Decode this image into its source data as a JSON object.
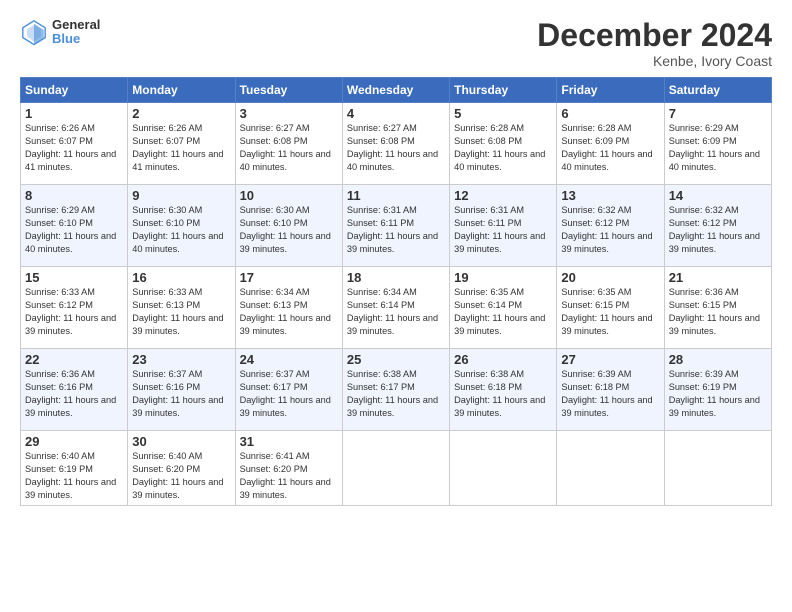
{
  "header": {
    "logo_text_top": "General",
    "logo_text_bottom": "Blue",
    "month_title": "December 2024",
    "location": "Kenbe, Ivory Coast"
  },
  "weekdays": [
    "Sunday",
    "Monday",
    "Tuesday",
    "Wednesday",
    "Thursday",
    "Friday",
    "Saturday"
  ],
  "weeks": [
    [
      {
        "day": "1",
        "sunrise": "6:26 AM",
        "sunset": "6:07 PM",
        "daylight": "11 hours and 41 minutes."
      },
      {
        "day": "2",
        "sunrise": "6:26 AM",
        "sunset": "6:07 PM",
        "daylight": "11 hours and 41 minutes."
      },
      {
        "day": "3",
        "sunrise": "6:27 AM",
        "sunset": "6:08 PM",
        "daylight": "11 hours and 40 minutes."
      },
      {
        "day": "4",
        "sunrise": "6:27 AM",
        "sunset": "6:08 PM",
        "daylight": "11 hours and 40 minutes."
      },
      {
        "day": "5",
        "sunrise": "6:28 AM",
        "sunset": "6:08 PM",
        "daylight": "11 hours and 40 minutes."
      },
      {
        "day": "6",
        "sunrise": "6:28 AM",
        "sunset": "6:09 PM",
        "daylight": "11 hours and 40 minutes."
      },
      {
        "day": "7",
        "sunrise": "6:29 AM",
        "sunset": "6:09 PM",
        "daylight": "11 hours and 40 minutes."
      }
    ],
    [
      {
        "day": "8",
        "sunrise": "6:29 AM",
        "sunset": "6:10 PM",
        "daylight": "11 hours and 40 minutes."
      },
      {
        "day": "9",
        "sunrise": "6:30 AM",
        "sunset": "6:10 PM",
        "daylight": "11 hours and 40 minutes."
      },
      {
        "day": "10",
        "sunrise": "6:30 AM",
        "sunset": "6:10 PM",
        "daylight": "11 hours and 39 minutes."
      },
      {
        "day": "11",
        "sunrise": "6:31 AM",
        "sunset": "6:11 PM",
        "daylight": "11 hours and 39 minutes."
      },
      {
        "day": "12",
        "sunrise": "6:31 AM",
        "sunset": "6:11 PM",
        "daylight": "11 hours and 39 minutes."
      },
      {
        "day": "13",
        "sunrise": "6:32 AM",
        "sunset": "6:12 PM",
        "daylight": "11 hours and 39 minutes."
      },
      {
        "day": "14",
        "sunrise": "6:32 AM",
        "sunset": "6:12 PM",
        "daylight": "11 hours and 39 minutes."
      }
    ],
    [
      {
        "day": "15",
        "sunrise": "6:33 AM",
        "sunset": "6:12 PM",
        "daylight": "11 hours and 39 minutes."
      },
      {
        "day": "16",
        "sunrise": "6:33 AM",
        "sunset": "6:13 PM",
        "daylight": "11 hours and 39 minutes."
      },
      {
        "day": "17",
        "sunrise": "6:34 AM",
        "sunset": "6:13 PM",
        "daylight": "11 hours and 39 minutes."
      },
      {
        "day": "18",
        "sunrise": "6:34 AM",
        "sunset": "6:14 PM",
        "daylight": "11 hours and 39 minutes."
      },
      {
        "day": "19",
        "sunrise": "6:35 AM",
        "sunset": "6:14 PM",
        "daylight": "11 hours and 39 minutes."
      },
      {
        "day": "20",
        "sunrise": "6:35 AM",
        "sunset": "6:15 PM",
        "daylight": "11 hours and 39 minutes."
      },
      {
        "day": "21",
        "sunrise": "6:36 AM",
        "sunset": "6:15 PM",
        "daylight": "11 hours and 39 minutes."
      }
    ],
    [
      {
        "day": "22",
        "sunrise": "6:36 AM",
        "sunset": "6:16 PM",
        "daylight": "11 hours and 39 minutes."
      },
      {
        "day": "23",
        "sunrise": "6:37 AM",
        "sunset": "6:16 PM",
        "daylight": "11 hours and 39 minutes."
      },
      {
        "day": "24",
        "sunrise": "6:37 AM",
        "sunset": "6:17 PM",
        "daylight": "11 hours and 39 minutes."
      },
      {
        "day": "25",
        "sunrise": "6:38 AM",
        "sunset": "6:17 PM",
        "daylight": "11 hours and 39 minutes."
      },
      {
        "day": "26",
        "sunrise": "6:38 AM",
        "sunset": "6:18 PM",
        "daylight": "11 hours and 39 minutes."
      },
      {
        "day": "27",
        "sunrise": "6:39 AM",
        "sunset": "6:18 PM",
        "daylight": "11 hours and 39 minutes."
      },
      {
        "day": "28",
        "sunrise": "6:39 AM",
        "sunset": "6:19 PM",
        "daylight": "11 hours and 39 minutes."
      }
    ],
    [
      {
        "day": "29",
        "sunrise": "6:40 AM",
        "sunset": "6:19 PM",
        "daylight": "11 hours and 39 minutes."
      },
      {
        "day": "30",
        "sunrise": "6:40 AM",
        "sunset": "6:20 PM",
        "daylight": "11 hours and 39 minutes."
      },
      {
        "day": "31",
        "sunrise": "6:41 AM",
        "sunset": "6:20 PM",
        "daylight": "11 hours and 39 minutes."
      },
      null,
      null,
      null,
      null
    ]
  ]
}
